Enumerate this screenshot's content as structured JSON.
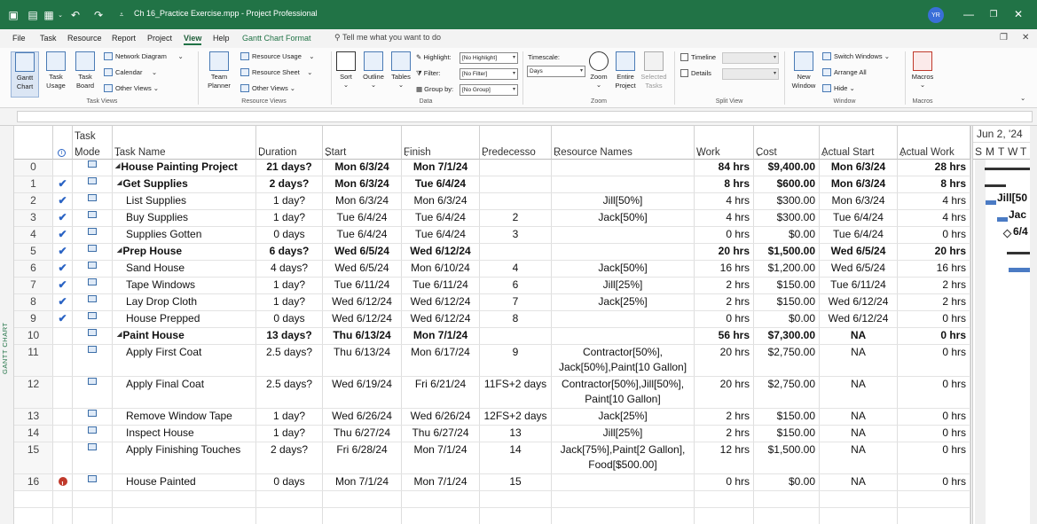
{
  "titlebar": {
    "file_title": "Ch 16_Practice Exercise.mpp  -  Project Professional",
    "user_initials": "YR",
    "qat": {
      "undo": "↶",
      "redo": "↷"
    }
  },
  "menu": {
    "tabs": [
      "File",
      "Task",
      "Resource",
      "Report",
      "Project",
      "View",
      "Help",
      "Gantt Chart Format"
    ],
    "active_tab": "View",
    "tell_me": "Tell me what you want to do"
  },
  "ribbon": {
    "task_views": {
      "gantt_chart": "Gantt Chart",
      "task_usage": "Task Usage",
      "task_board": "Task Board",
      "network_diagram": "Network Diagram",
      "calendar": "Calendar",
      "other_views": "Other Views",
      "group_label": "Task Views"
    },
    "resource_views": {
      "team_planner": "Team Planner",
      "resource_usage": "Resource Usage",
      "resource_sheet": "Resource Sheet",
      "other_views": "Other Views",
      "group_label": "Resource Views"
    },
    "data": {
      "sort": "Sort",
      "outline": "Outline",
      "tables": "Tables",
      "highlight_label": "Highlight:",
      "highlight_value": "[No Highlight]",
      "filter_label": "Filter:",
      "filter_value": "[No Filter]",
      "group_label_text": "Group by:",
      "group_value": "[No Group]",
      "group_label": "Data"
    },
    "zoom": {
      "timescale_label": "Timescale:",
      "timescale_value": "Days",
      "zoom": "Zoom",
      "entire_project": "Entire Project",
      "selected_tasks": "Selected Tasks",
      "group_label": "Zoom"
    },
    "split_view": {
      "timeline": "Timeline",
      "details": "Details",
      "group_label": "Split View"
    },
    "window": {
      "new_window": "New Window",
      "switch_windows": "Switch Windows",
      "arrange_all": "Arrange All",
      "hide": "Hide",
      "group_label": "Window"
    },
    "macros": {
      "macros": "Macros",
      "group_label": "Macros"
    }
  },
  "sidebar": {
    "label": "GANTT CHART"
  },
  "table": {
    "headers": {
      "task_mode_top": "Task",
      "task_mode_bottom": "Mode",
      "task_name": "Task Name",
      "duration": "Duration",
      "start": "Start",
      "finish": "Finish",
      "predecessors": "Predecesso",
      "resource_names": "Resource Names",
      "work": "Work",
      "cost": "Cost",
      "actual_start": "Actual Start",
      "actual_work": "Actual Work"
    },
    "rows": [
      {
        "id": "0",
        "done": "",
        "info": "",
        "summary": true,
        "indent": 0,
        "name": "House Painting Project",
        "duration": "21 days?",
        "start": "Mon 6/3/24",
        "finish": "Mon 7/1/24",
        "pred": "",
        "res": "",
        "res2": "",
        "work": "84 hrs",
        "cost": "$9,400.00",
        "astart": "Mon 6/3/24",
        "awork": "28 hrs"
      },
      {
        "id": "1",
        "done": "✔",
        "info": "",
        "summary": true,
        "indent": 1,
        "name": "Get Supplies",
        "duration": "2 days?",
        "start": "Mon 6/3/24",
        "finish": "Tue 6/4/24",
        "pred": "",
        "res": "",
        "res2": "",
        "work": "8 hrs",
        "cost": "$600.00",
        "astart": "Mon 6/3/24",
        "awork": "8 hrs"
      },
      {
        "id": "2",
        "done": "✔",
        "info": "",
        "summary": false,
        "indent": 2,
        "name": "List Supplies",
        "duration": "1 day?",
        "start": "Mon 6/3/24",
        "finish": "Mon 6/3/24",
        "pred": "",
        "res": "Jill[50%]",
        "res2": "",
        "work": "4 hrs",
        "cost": "$300.00",
        "astart": "Mon 6/3/24",
        "awork": "4 hrs"
      },
      {
        "id": "3",
        "done": "✔",
        "info": "",
        "summary": false,
        "indent": 2,
        "name": "Buy Supplies",
        "duration": "1 day?",
        "start": "Tue 6/4/24",
        "finish": "Tue 6/4/24",
        "pred": "2",
        "res": "Jack[50%]",
        "res2": "",
        "work": "4 hrs",
        "cost": "$300.00",
        "astart": "Tue 6/4/24",
        "awork": "4 hrs"
      },
      {
        "id": "4",
        "done": "✔",
        "info": "",
        "summary": false,
        "indent": 2,
        "name": "Supplies Gotten",
        "duration": "0 days",
        "start": "Tue 6/4/24",
        "finish": "Tue 6/4/24",
        "pred": "3",
        "res": "",
        "res2": "",
        "work": "0 hrs",
        "cost": "$0.00",
        "astart": "Tue 6/4/24",
        "awork": "0 hrs"
      },
      {
        "id": "5",
        "done": "✔",
        "info": "",
        "summary": true,
        "indent": 1,
        "name": "Prep House",
        "duration": "6 days?",
        "start": "Wed 6/5/24",
        "finish": "Wed 6/12/24",
        "pred": "",
        "res": "",
        "res2": "",
        "work": "20 hrs",
        "cost": "$1,500.00",
        "astart": "Wed 6/5/24",
        "awork": "20 hrs"
      },
      {
        "id": "6",
        "done": "✔",
        "info": "",
        "summary": false,
        "indent": 2,
        "name": "Sand House",
        "duration": "4 days?",
        "start": "Wed 6/5/24",
        "finish": "Mon 6/10/24",
        "pred": "4",
        "res": "Jack[50%]",
        "res2": "",
        "work": "16 hrs",
        "cost": "$1,200.00",
        "astart": "Wed 6/5/24",
        "awork": "16 hrs"
      },
      {
        "id": "7",
        "done": "✔",
        "info": "",
        "summary": false,
        "indent": 2,
        "name": "Tape Windows",
        "duration": "1 day?",
        "start": "Tue 6/11/24",
        "finish": "Tue 6/11/24",
        "pred": "6",
        "res": "Jill[25%]",
        "res2": "",
        "work": "2 hrs",
        "cost": "$150.00",
        "astart": "Tue 6/11/24",
        "awork": "2 hrs"
      },
      {
        "id": "8",
        "done": "✔",
        "info": "",
        "summary": false,
        "indent": 2,
        "name": "Lay Drop Cloth",
        "duration": "1 day?",
        "start": "Wed 6/12/24",
        "finish": "Wed 6/12/24",
        "pred": "7",
        "res": "Jack[25%]",
        "res2": "",
        "work": "2 hrs",
        "cost": "$150.00",
        "astart": "Wed 6/12/24",
        "awork": "2 hrs"
      },
      {
        "id": "9",
        "done": "✔",
        "info": "",
        "summary": false,
        "indent": 2,
        "name": "House Prepped",
        "duration": "0 days",
        "start": "Wed 6/12/24",
        "finish": "Wed 6/12/24",
        "pred": "8",
        "res": "",
        "res2": "",
        "work": "0 hrs",
        "cost": "$0.00",
        "astart": "Wed 6/12/24",
        "awork": "0 hrs"
      },
      {
        "id": "10",
        "done": "",
        "info": "",
        "summary": true,
        "indent": 1,
        "name": "Paint House",
        "duration": "13 days?",
        "start": "Thu 6/13/24",
        "finish": "Mon 7/1/24",
        "pred": "",
        "res": "",
        "res2": "",
        "work": "56 hrs",
        "cost": "$7,300.00",
        "astart": "NA",
        "awork": "0 hrs"
      },
      {
        "id": "11",
        "done": "",
        "info": "",
        "summary": false,
        "indent": 2,
        "name": "Apply First Coat",
        "duration": "2.5 days?",
        "start": "Thu 6/13/24",
        "finish": "Mon 6/17/24",
        "pred": "9",
        "res": "Contractor[50%],",
        "res2": "Jack[50%],Paint[10 Gallon]",
        "work": "20 hrs",
        "cost": "$2,750.00",
        "astart": "NA",
        "awork": "0 hrs"
      },
      {
        "id": "12",
        "done": "",
        "info": "",
        "summary": false,
        "indent": 2,
        "name": "Apply Final Coat",
        "duration": "2.5 days?",
        "start": "Wed 6/19/24",
        "finish": "Fri 6/21/24",
        "pred": "11FS+2 days",
        "res": "Contractor[50%],Jill[50%],",
        "res2": "Paint[10 Gallon]",
        "work": "20 hrs",
        "cost": "$2,750.00",
        "astart": "NA",
        "awork": "0 hrs"
      },
      {
        "id": "13",
        "done": "",
        "info": "",
        "summary": false,
        "indent": 2,
        "name": "Remove Window Tape",
        "duration": "1 day?",
        "start": "Wed 6/26/24",
        "finish": "Wed 6/26/24",
        "pred": "12FS+2 days",
        "res": "Jack[25%]",
        "res2": "",
        "work": "2 hrs",
        "cost": "$150.00",
        "astart": "NA",
        "awork": "0 hrs"
      },
      {
        "id": "14",
        "done": "",
        "info": "",
        "summary": false,
        "indent": 2,
        "name": "Inspect House",
        "duration": "1 day?",
        "start": "Thu 6/27/24",
        "finish": "Thu 6/27/24",
        "pred": "13",
        "res": "Jill[25%]",
        "res2": "",
        "work": "2 hrs",
        "cost": "$150.00",
        "astart": "NA",
        "awork": "0 hrs"
      },
      {
        "id": "15",
        "done": "",
        "info": "",
        "summary": false,
        "indent": 2,
        "name": "Apply Finishing Touches",
        "duration": "2 days?",
        "start": "Fri 6/28/24",
        "finish": "Mon 7/1/24",
        "pred": "14",
        "res": "Jack[75%],Paint[2 Gallon],",
        "res2": "Food[$500.00]",
        "work": "12 hrs",
        "cost": "$1,500.00",
        "astart": "NA",
        "awork": "0 hrs"
      },
      {
        "id": "16",
        "done": "",
        "info": "!",
        "summary": false,
        "indent": 2,
        "name": "House Painted",
        "duration": "0 days",
        "start": "Mon 7/1/24",
        "finish": "Mon 7/1/24",
        "pred": "15",
        "res": "",
        "res2": "",
        "work": "0 hrs",
        "cost": "$0.00",
        "astart": "NA",
        "awork": "0 hrs"
      }
    ]
  },
  "gantt": {
    "week_label": "Jun 2, '24",
    "days": [
      "S",
      "M",
      "T",
      "W",
      "T"
    ],
    "labels": {
      "row2": "Jill[50",
      "row3": "Jac",
      "row4": "6/4"
    }
  }
}
